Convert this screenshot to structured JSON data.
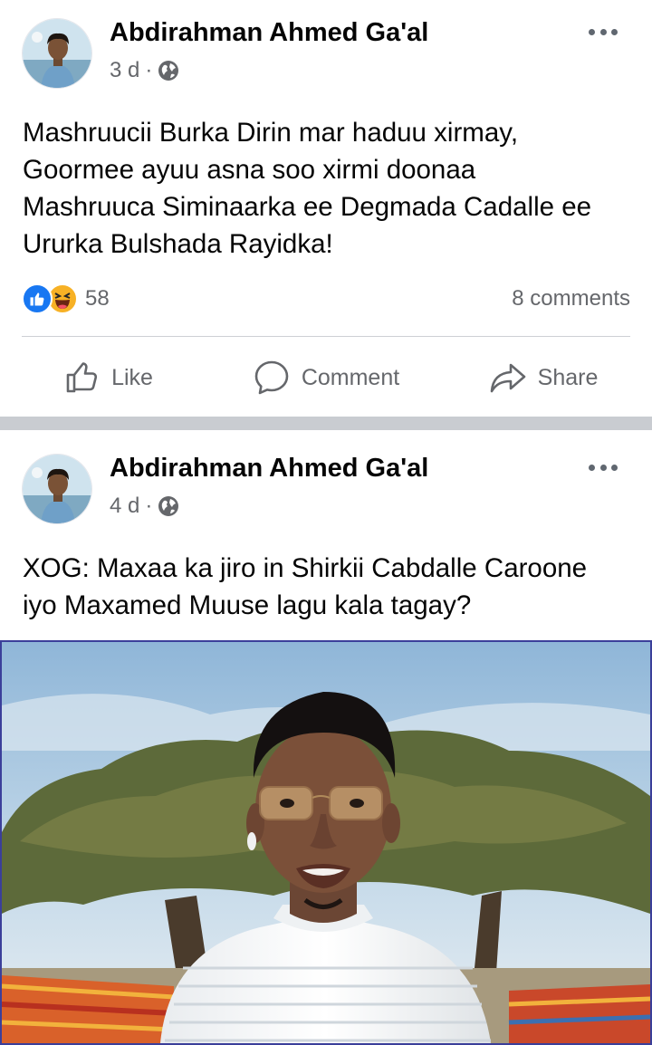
{
  "colors": {
    "accent": "#1877f2",
    "secondary_text": "#65676b",
    "separator": "#c9ccd1"
  },
  "posts": [
    {
      "author": "Abdirahman Ahmed Ga'al",
      "time": "3 d",
      "separator": "·",
      "privacy_icon": "globe-icon",
      "lines": [
        "Mashruucii Burka Dirin mar haduu xirmay,",
        "Goormee ayuu asna soo xirmi doonaa",
        "Mashruuca Siminaarka ee Degmada Cadalle ee",
        "Ururka Bulshada Rayidka!"
      ],
      "reaction_icons": [
        "like-reaction-icon",
        "haha-reaction-icon"
      ],
      "reactions_count": "58",
      "comments_label": "8 comments",
      "actions": {
        "like": "Like",
        "comment": "Comment",
        "share": "Share"
      }
    },
    {
      "author": "Abdirahman Ahmed Ga'al",
      "time": "4 d",
      "separator": "·",
      "privacy_icon": "globe-icon",
      "lines": [
        "XOG: Maxaa ka jiro in Shirkii Cabdalle Caroone",
        "iyo Maxamed Muuse lagu kala tagay?"
      ]
    }
  ]
}
